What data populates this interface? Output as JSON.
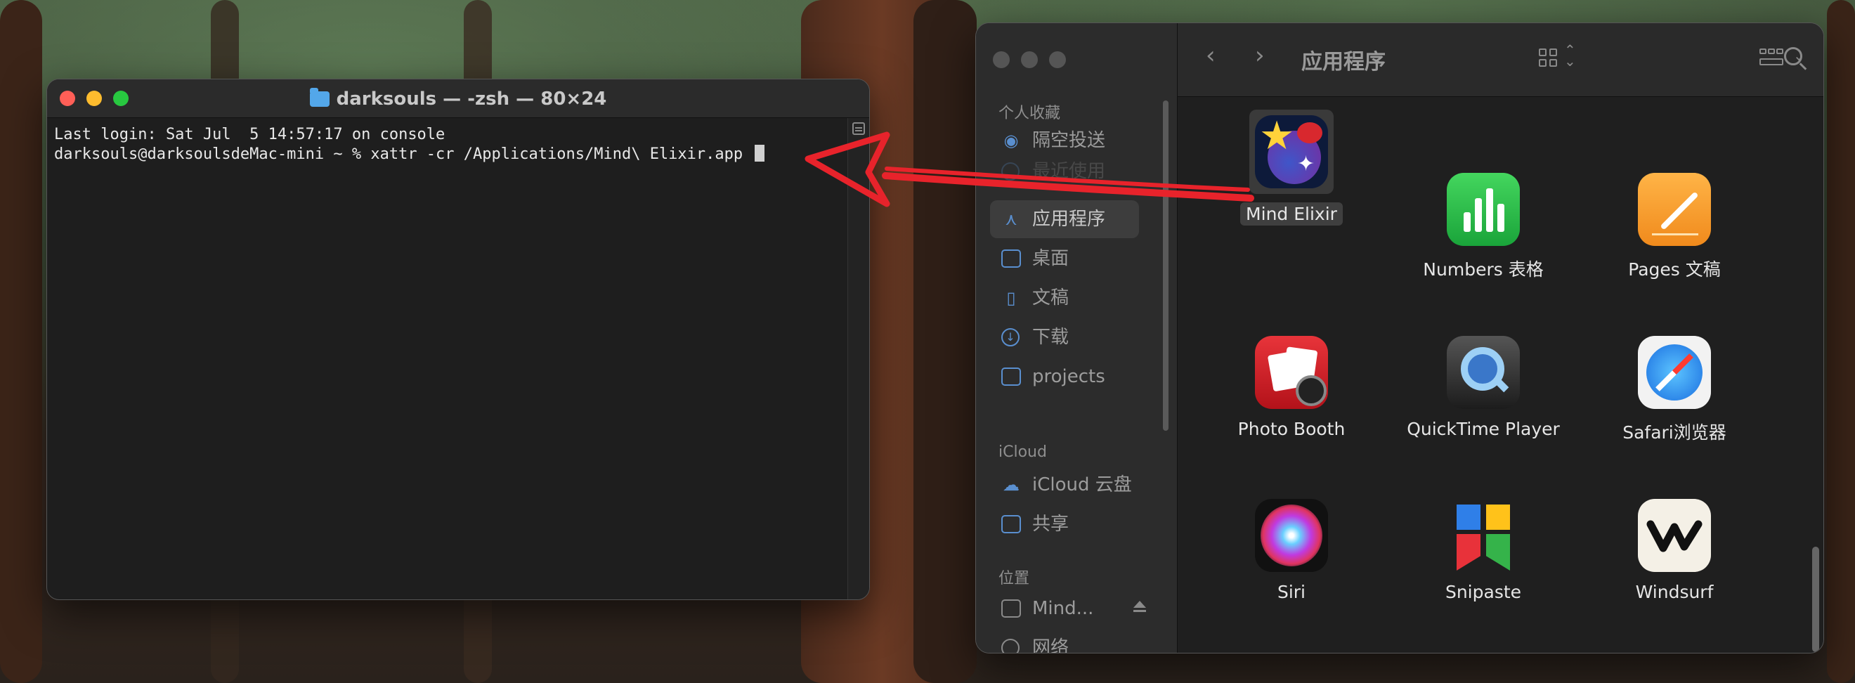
{
  "terminal": {
    "title": "darksouls — -zsh — 80×24",
    "line1": "Last login: Sat Jul  5 14:57:17 on console",
    "line2": "darksouls@darksoulsdeMac-mini ~ % xattr -cr /Applications/Mind\\ Elixir.app "
  },
  "finder": {
    "title": "应用程序",
    "sidebar": {
      "favorites_header": "个人收藏",
      "icloud_header": "iCloud",
      "locations_header": "位置",
      "items": [
        {
          "label": "隔空投送",
          "icon": "airdrop-icon"
        },
        {
          "label": "最近使用",
          "icon": "clock-icon"
        },
        {
          "label": "应用程序",
          "icon": "applications-icon"
        },
        {
          "label": "桌面",
          "icon": "desktop-icon"
        },
        {
          "label": "文稿",
          "icon": "document-icon"
        },
        {
          "label": "下载",
          "icon": "download-icon"
        },
        {
          "label": "projects",
          "icon": "folder-icon"
        },
        {
          "label": "iCloud 云盘",
          "icon": "cloud-icon"
        },
        {
          "label": "共享",
          "icon": "shared-folder-icon"
        },
        {
          "label": "Mind...",
          "icon": "disk-icon"
        },
        {
          "label": "网络",
          "icon": "network-icon"
        }
      ]
    },
    "apps": [
      {
        "label": "Mind Elixir",
        "icon": "mind-elixir-icon",
        "selected": true
      },
      {
        "label": "Numbers 表格",
        "icon": "numbers-icon"
      },
      {
        "label": "Pages 文稿",
        "icon": "pages-icon"
      },
      {
        "label": "Photo Booth",
        "icon": "photo-booth-icon"
      },
      {
        "label": "QuickTime Player",
        "icon": "quicktime-icon"
      },
      {
        "label": "Safari浏览器",
        "icon": "safari-icon"
      },
      {
        "label": "Siri",
        "icon": "siri-icon"
      },
      {
        "label": "Snipaste",
        "icon": "snipaste-icon"
      },
      {
        "label": "Windsurf",
        "icon": "windsurf-icon"
      }
    ]
  },
  "colors": {
    "accent_blue": "#5a8fcf",
    "arrow_red": "#e8232b",
    "numbers_green": "#2fc24d",
    "pages_orange": "#f7a233"
  }
}
